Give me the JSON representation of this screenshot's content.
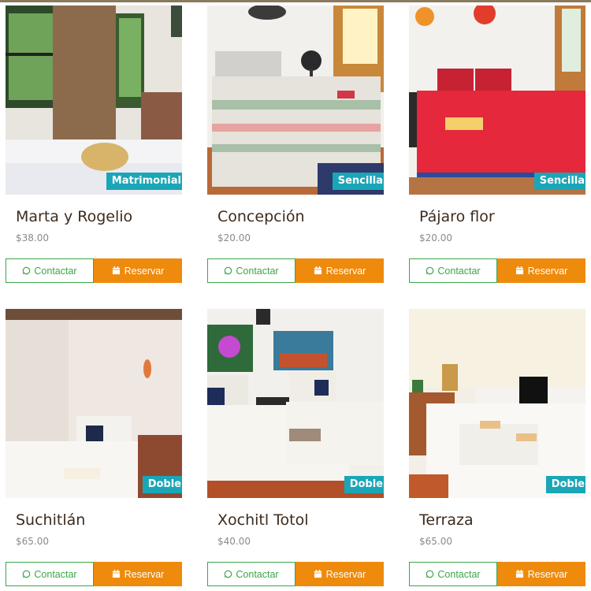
{
  "rooms": [
    {
      "name": "Marta y Rogelio",
      "price": "$38.00",
      "type": "Matrimonial",
      "contact_label": "Contactar",
      "reserve_label": "Reservar"
    },
    {
      "name": "Concepción",
      "price": "$20.00",
      "type": "Sencilla",
      "contact_label": "Contactar",
      "reserve_label": "Reservar"
    },
    {
      "name": "Pájaro flor",
      "price": "$20.00",
      "type": "Sencilla",
      "contact_label": "Contactar",
      "reserve_label": "Reservar"
    },
    {
      "name": "Suchitlán",
      "price": "$65.00",
      "type": "Doble",
      "contact_label": "Contactar",
      "reserve_label": "Reservar"
    },
    {
      "name": "Xochitl Totol",
      "price": "$40.00",
      "type": "Doble",
      "contact_label": "Contactar",
      "reserve_label": "Reservar"
    },
    {
      "name": "Terraza",
      "price": "$65.00",
      "type": "Doble",
      "contact_label": "Contactar",
      "reserve_label": "Reservar"
    }
  ],
  "icons": {
    "contact": "whatsapp-icon",
    "reserve": "calendar-icon"
  },
  "colors": {
    "badge": "#1aa6b7",
    "contact": "#3ca64a",
    "reserve": "#ee8a0c",
    "title": "#3d2b1e",
    "price": "#8a8a8a"
  }
}
